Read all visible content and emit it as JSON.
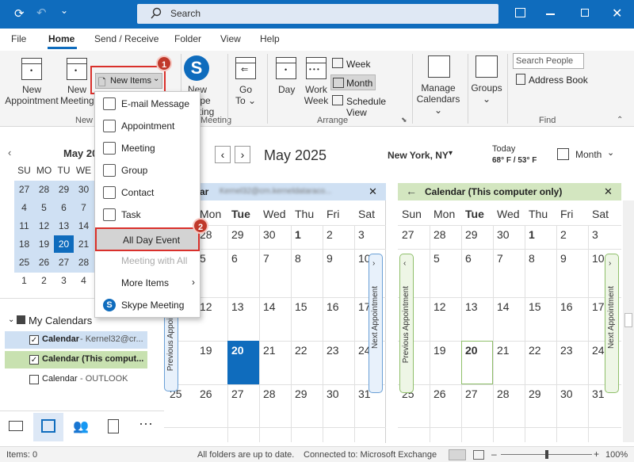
{
  "titlebar": {
    "search_placeholder": "Search"
  },
  "tabs": [
    "File",
    "Home",
    "Send / Receive",
    "Folder",
    "View",
    "Help"
  ],
  "ribbon": {
    "new_appointment": [
      "New",
      "Appointment"
    ],
    "new_meeting": [
      "New",
      "Meeting"
    ],
    "new_items": "New Items",
    "group_new": "New",
    "skype": [
      "New Skype",
      "Meeting"
    ],
    "skype_group": "Meeting",
    "goto": [
      "Go",
      "To"
    ],
    "day": "Day",
    "work_week": [
      "Work",
      "Week"
    ],
    "week": "Week",
    "month": "Month",
    "schedule_view": "Schedule View",
    "group_arrange": "Arrange",
    "manage_calendars": [
      "Manage",
      "Calendars"
    ],
    "groups": "Groups",
    "search_people": "Search People",
    "address_book": "Address Book",
    "group_find": "Find"
  },
  "menu": {
    "items": [
      {
        "label": "E-mail Message",
        "icon": "mail-icon",
        "enabled": true
      },
      {
        "label": "Appointment",
        "icon": "calendar-icon",
        "enabled": true
      },
      {
        "label": "Meeting",
        "icon": "meeting-icon",
        "enabled": true
      },
      {
        "label": "Group",
        "icon": "group-icon",
        "enabled": true
      },
      {
        "label": "Contact",
        "icon": "contact-icon",
        "enabled": true
      },
      {
        "label": "Task",
        "icon": "task-icon",
        "enabled": true
      },
      {
        "label": "All Day Event",
        "icon": "",
        "enabled": true
      },
      {
        "label": "Meeting with All",
        "icon": "",
        "enabled": false
      },
      {
        "label": "More Items",
        "icon": "",
        "enabled": true
      },
      {
        "label": "Skype Meeting",
        "icon": "skype-icon",
        "enabled": true
      }
    ]
  },
  "badges": [
    "1",
    "2"
  ],
  "mini_calendar": {
    "title": "May 20",
    "weekdays": [
      "SU",
      "MO",
      "TU",
      "WE"
    ],
    "rows": [
      [
        "27",
        "28",
        "29",
        "30"
      ],
      [
        "4",
        "5",
        "6",
        "7"
      ],
      [
        "11",
        "12",
        "13",
        "14"
      ],
      [
        "18",
        "19",
        "20",
        "21"
      ],
      [
        "25",
        "26",
        "27",
        "28"
      ],
      [
        "1",
        "2",
        "3",
        "4"
      ]
    ],
    "selected": "20"
  },
  "folders": {
    "header": "My Calendars",
    "items": [
      {
        "label": "Calendar",
        "suffix": " - Kernel32@cr...",
        "checked": true,
        "color": "#cfe0f3"
      },
      {
        "label": "Calendar (This comput...",
        "suffix": "",
        "checked": true,
        "color": "#c8e1b0"
      },
      {
        "label": "Calendar",
        "suffix": " - OUTLOOK",
        "checked": false,
        "color": ""
      }
    ]
  },
  "nav": {
    "month_title": "May 2025",
    "location": "New York, NY",
    "today_label": "Today",
    "today_temp": "68° F / 53° F",
    "view": "Month"
  },
  "cal1": {
    "header_prefix": "ar",
    "header_email": "Kernel32@crn.kerneldataraco...",
    "days": [
      "Mon",
      "Tue",
      "Wed",
      "Thu",
      "Fri",
      "Sat"
    ],
    "weeks": [
      [
        "28",
        "29",
        "30",
        "1",
        "2",
        "3"
      ],
      [
        "5",
        "6",
        "7",
        "8",
        "9",
        "10"
      ],
      [
        "12",
        "13",
        "14",
        "15",
        "16",
        "17"
      ],
      [
        "19",
        "20",
        "21",
        "22",
        "23",
        "24"
      ],
      [
        "26",
        "27",
        "28",
        "29",
        "30",
        "31"
      ]
    ],
    "first_col": [
      "",
      "",
      "",
      "",
      "25"
    ],
    "prev_label": "Previous Appointment",
    "next_label": "Next Appointment"
  },
  "cal2": {
    "header": "Calendar (This computer only)",
    "days": [
      "Sun",
      "Mon",
      "Tue",
      "Wed",
      "Thu",
      "Fri",
      "Sat"
    ],
    "weeks": [
      [
        "27",
        "28",
        "29",
        "30",
        "1",
        "2",
        "3"
      ],
      [
        "4",
        "5",
        "6",
        "7",
        "8",
        "9",
        "10"
      ],
      [
        "11",
        "12",
        "13",
        "14",
        "15",
        "16",
        "17"
      ],
      [
        "18",
        "19",
        "20",
        "21",
        "22",
        "23",
        "24"
      ],
      [
        "25",
        "26",
        "27",
        "28",
        "29",
        "30",
        "31"
      ]
    ],
    "prev_label": "Previous Appointment",
    "next_label": "Next Appointment"
  },
  "status": {
    "items": "Items: 0",
    "folders": "All folders are up to date.",
    "connected": "Connected to: Microsoft Exchange",
    "zoom": "100%"
  }
}
